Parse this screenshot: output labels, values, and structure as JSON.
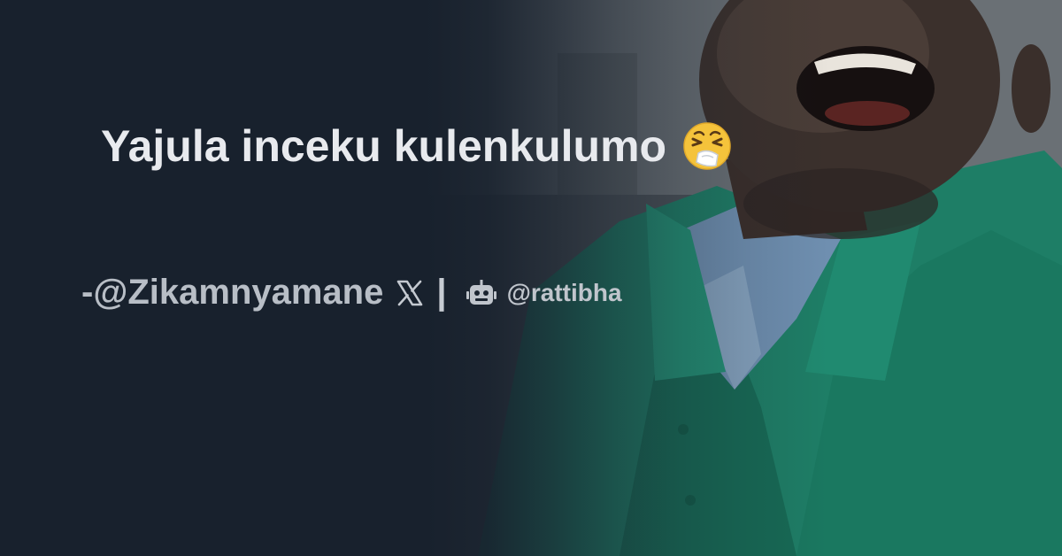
{
  "card": {
    "title": "Yajula inceku kulenkulumo",
    "title_emoji_icon": "sneezing-face-icon",
    "author_prefix": "- ",
    "author_handle": "@Zikamnyamane",
    "platform_icon": "x-logo-icon",
    "separator": "|",
    "bot_icon": "robot-icon",
    "brand_handle": "@rattibha"
  },
  "colors": {
    "background": "#18212d",
    "title_text": "#e8eaee",
    "byline_text": "#b8bec6",
    "emoji_face": "#f5c33b",
    "shirt_green": "#1f8a6e"
  }
}
